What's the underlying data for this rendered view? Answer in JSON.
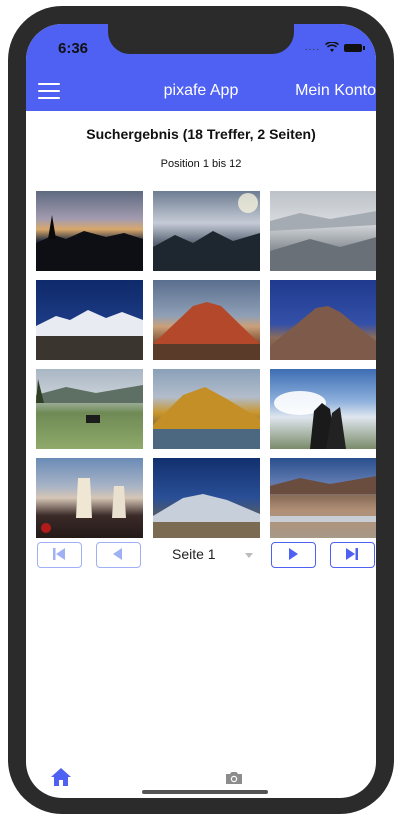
{
  "status_bar": {
    "time": "6:36",
    "signal_dots": "....",
    "wifi_icon": "wifi-icon",
    "battery_icon": "battery-icon"
  },
  "header": {
    "menu_icon": "hamburger-icon",
    "title": "pixafe App",
    "account_label": "Mein Konto",
    "color": "#4e61f2"
  },
  "results": {
    "title": "Suchergebnis (18 Treffer, 2 Seiten)",
    "position": "Position 1 bis 12"
  },
  "photos": [
    "Sonnenuntergang über Bergsilhouette mit Baum",
    "Nebelige Berglandschaft mit Sonne",
    "Bergketten im Dunst",
    "Schneebedeckter Bergkamm bei Nacht",
    "Vulkan im Abendrot",
    "Vulkan am Abend",
    "Personen auf einer Hochebene",
    "Gelber Berg mit See",
    "Motorradfahrer vor Wolken",
    "Personen in Decken bei Dämmerung",
    "Hochebene mit Bergkette",
    "Steppe mit Bergen"
  ],
  "pagination": {
    "first_icon": "first-page-icon",
    "prev_icon": "previous-page-icon",
    "page_label": "Seite 1",
    "next_icon": "next-page-icon",
    "last_icon": "last-page-icon"
  },
  "tabbar": {
    "home_icon": "home-icon",
    "camera_icon": "camera-icon"
  }
}
